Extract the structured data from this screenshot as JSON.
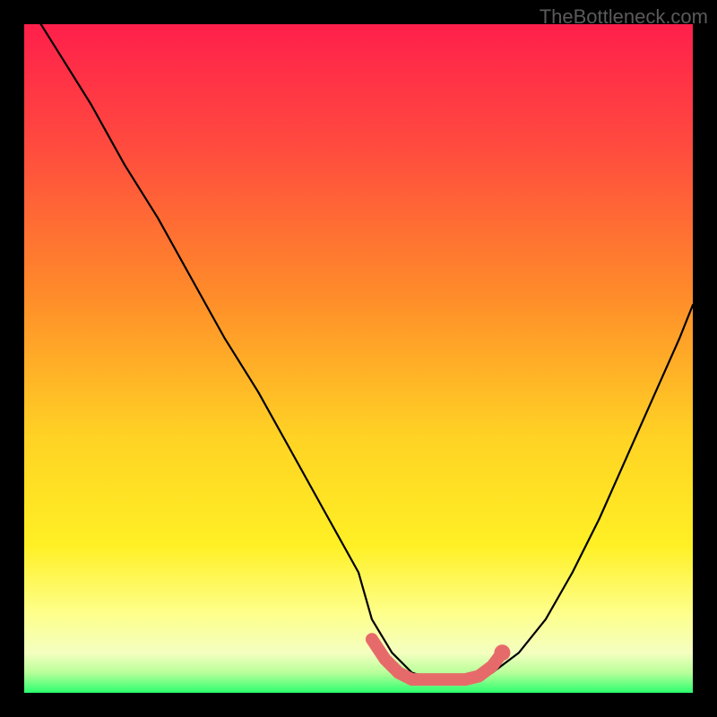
{
  "watermark": "TheBottleneck.com",
  "colors": {
    "bg": "#000000",
    "gradient_top": "#ff1f4b",
    "gradient_mid1": "#ff8a2a",
    "gradient_mid2": "#ffe625",
    "gradient_mid3": "#feff8a",
    "gradient_bottom": "#2bff6e",
    "curve": "#000000",
    "marker": "#e76a6a"
  },
  "chart_data": {
    "type": "line",
    "title": "",
    "xlabel": "",
    "ylabel": "",
    "xlim": [
      0,
      100
    ],
    "ylim": [
      0,
      100
    ],
    "series": [
      {
        "name": "bottleneck-curve",
        "x": [
          0,
          5,
          10,
          15,
          20,
          25,
          30,
          35,
          40,
          45,
          50,
          52,
          55,
          58,
          61,
          64,
          67,
          70,
          74,
          78,
          82,
          86,
          90,
          94,
          98,
          100
        ],
        "values": [
          104,
          96,
          88,
          79,
          71,
          62,
          53,
          45,
          36,
          27,
          18,
          11,
          6,
          3,
          2,
          2,
          2,
          3,
          6,
          11,
          18,
          26,
          35,
          44,
          53,
          58
        ]
      },
      {
        "name": "optimal-range-markers",
        "x": [
          52,
          54,
          56,
          58,
          60,
          62,
          64,
          66,
          68,
          70,
          71.5
        ],
        "values": [
          8,
          5,
          3,
          2,
          2,
          2,
          2,
          2,
          2.5,
          4,
          6
        ]
      }
    ],
    "annotations": []
  }
}
